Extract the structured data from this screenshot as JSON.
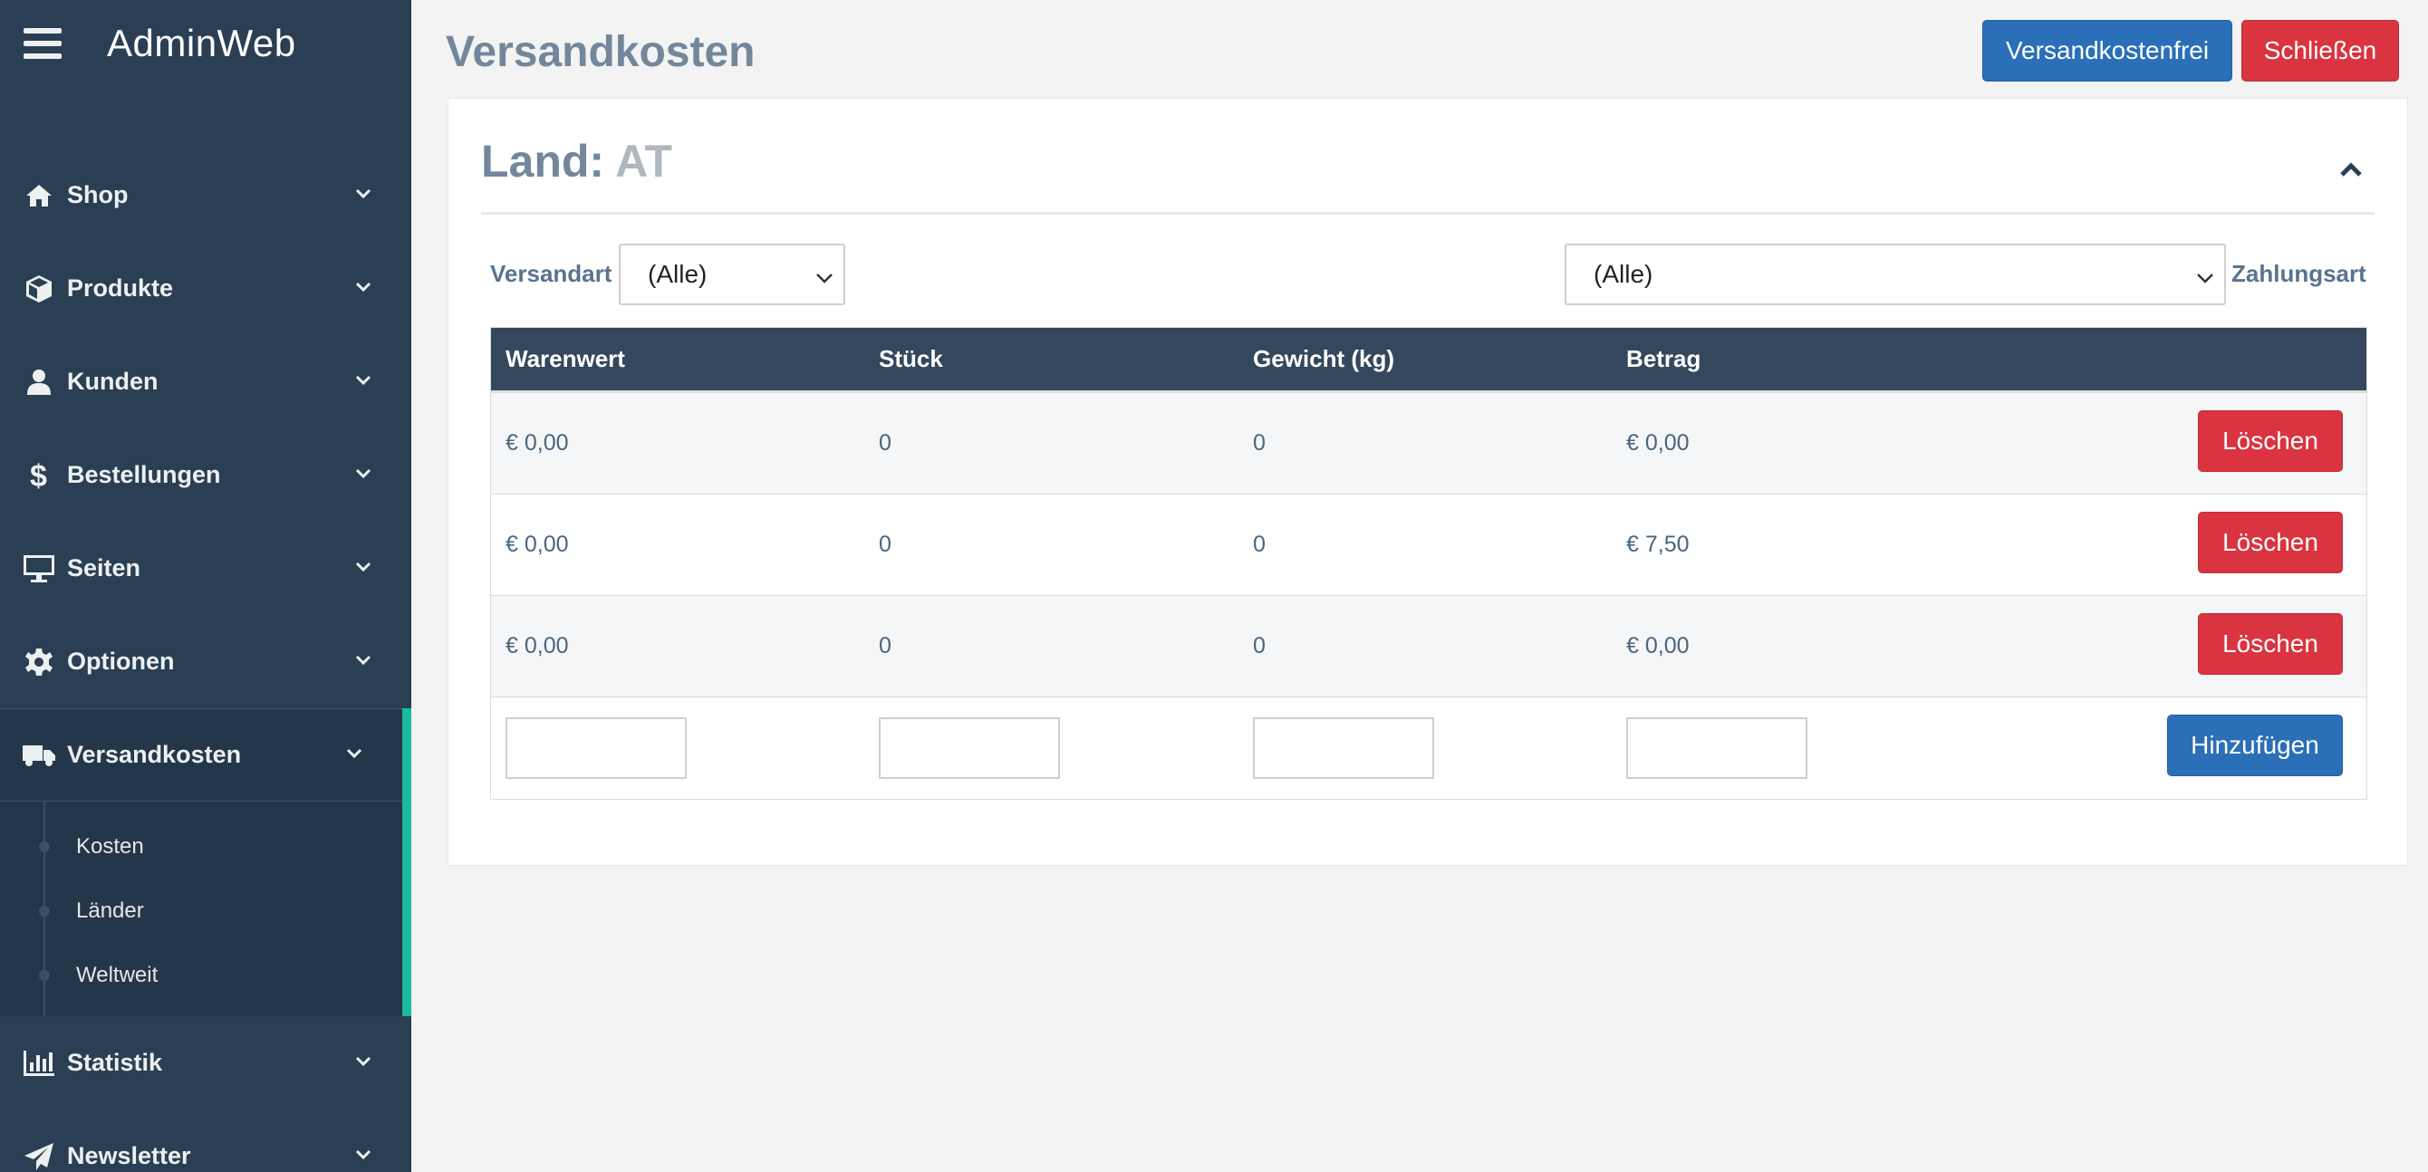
{
  "app": {
    "brand": "AdminWeb"
  },
  "sidebar": {
    "items": [
      {
        "label": "Shop",
        "icon": "home-icon"
      },
      {
        "label": "Produkte",
        "icon": "box-icon"
      },
      {
        "label": "Kunden",
        "icon": "user-icon"
      },
      {
        "label": "Bestellungen",
        "icon": "dollar-icon"
      },
      {
        "label": "Seiten",
        "icon": "desktop-icon"
      },
      {
        "label": "Optionen",
        "icon": "gear-icon"
      },
      {
        "label": "Versandkosten",
        "icon": "truck-icon",
        "active": true
      },
      {
        "label": "Statistik",
        "icon": "bar-chart-icon"
      },
      {
        "label": "Newsletter",
        "icon": "paper-plane-icon"
      }
    ],
    "submenu": [
      "Kosten",
      "Länder",
      "Weltweit"
    ]
  },
  "header": {
    "title": "Versandkosten",
    "free_button": "Versandkostenfrei",
    "close_button": "Schließen"
  },
  "panel": {
    "title_prefix": "Land:",
    "country": "AT"
  },
  "filters": {
    "versandart_label": "Versandart",
    "versandart_value": "(Alle)",
    "zahlungsart_label": "Zahlungsart",
    "zahlungsart_value": "(Alle)"
  },
  "table": {
    "headers": [
      "Warenwert",
      "Stück",
      "Gewicht (kg)",
      "Betrag"
    ],
    "rows": [
      {
        "warenwert": "€ 0,00",
        "stueck": "0",
        "gewicht": "0",
        "betrag": "€ 0,00",
        "action": "Löschen"
      },
      {
        "warenwert": "€ 0,00",
        "stueck": "0",
        "gewicht": "0",
        "betrag": "€ 7,50",
        "action": "Löschen"
      },
      {
        "warenwert": "€ 0,00",
        "stueck": "0",
        "gewicht": "0",
        "betrag": "€ 0,00",
        "action": "Löschen"
      }
    ],
    "add_button": "Hinzufügen"
  },
  "colors": {
    "sidebar_bg": "#2a3f54",
    "accent": "#1abb9c",
    "primary": "#2a6fb7",
    "danger": "#d9343f",
    "table_header": "#34475c"
  }
}
